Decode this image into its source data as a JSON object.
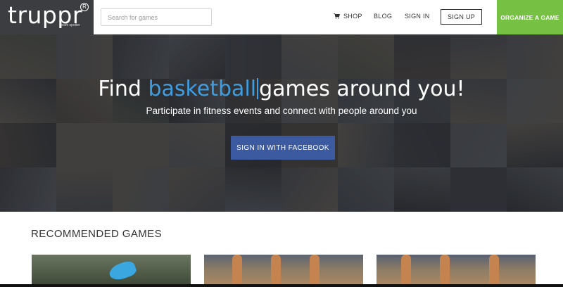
{
  "header": {
    "logo_text": "truppr",
    "logo_reg": "R",
    "logo_sub": "team spotter",
    "search_placeholder": "Search for games",
    "nav": {
      "shop": "SHOP",
      "blog": "BLOG",
      "signin": "SIGN IN"
    },
    "signup_label": "SIGN UP",
    "organize_label": "ORGANIZE A GAME"
  },
  "hero": {
    "title_prefix": "Find ",
    "title_highlight": "basketball",
    "title_suffix": "games around you!",
    "subtitle": "Participate in fitness events and connect with people around you",
    "facebook_button": "SIGN IN WITH FACEBOOK"
  },
  "recommended": {
    "title": "RECOMMENDED GAMES"
  },
  "colors": {
    "accent_green": "#76c043",
    "facebook_blue": "#3b5aa0",
    "highlight_blue": "#3f9de0",
    "logo_bg": "#3b3d40"
  }
}
